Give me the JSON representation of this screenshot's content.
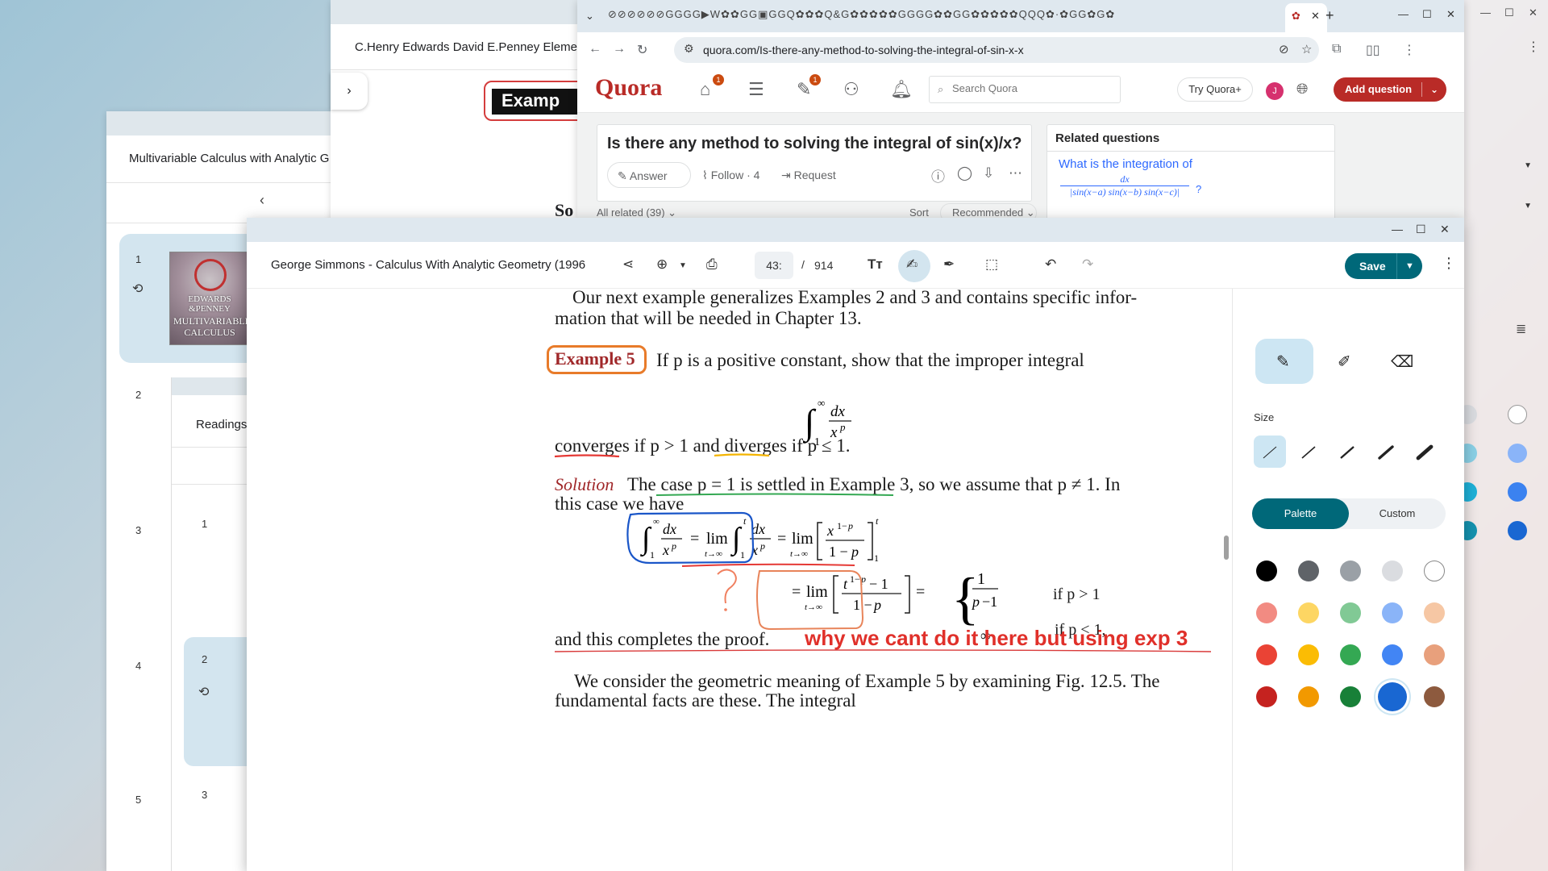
{
  "multi_window": {
    "title": "Multivariable Calculus with Analytic G",
    "thumb_pages": [
      "1",
      "2",
      "3",
      "4",
      "5"
    ],
    "cover_lines": [
      "EDWARDS",
      "&PENNEY",
      "MULTIVARIABLE",
      "CALCULUS"
    ],
    "sub_panel_label": "Readings",
    "sub_pages": [
      "1",
      "2",
      "3"
    ]
  },
  "edwards_window": {
    "title": "C.Henry Edwards David E.Penney Element",
    "heading_fragment": "Examp",
    "body_fragment": "So"
  },
  "chrome": {
    "tab_icons_text": "⊘⊘⊘⊘⊘⊘GGGG▶W✿✿GG▣GGQ✿✿✿Q&G✿✿✿✿✿GGGG✿✿GG✿✿✿✿✿QQQ✿·✿GG✿G✿",
    "url": "quora.com/Is-there-any-method-to-solving-the-integral-of-sin-x-x"
  },
  "quora": {
    "logo": "Quora",
    "home_badge": "1",
    "write_badge": "1",
    "search_placeholder": "Search Quora",
    "try_plus": "Try Quora+",
    "avatar_letter": "J",
    "add_question": "Add question",
    "question_title": "Is there any method to solving the integral of sin(x)/x?",
    "answer_label": "Answer",
    "follow_label": "Follow · 4",
    "request_label": "Request",
    "related_heading": "Related questions",
    "related_link": "What is the integration of",
    "related_frac_num": "dx",
    "related_frac_den": "|sin(x−a) sin(x−b) sin(x−c)|",
    "related_qmark": "?",
    "all_related": "All related (39)",
    "sort_label": "Sort",
    "sort_value": "Recommended"
  },
  "pdf": {
    "title": "George Simmons - Calculus With Analytic Geometry (1996",
    "page_current": "43:",
    "page_separator": "/",
    "page_total": "914",
    "save_label": "Save",
    "content": {
      "line1": "Our next example generalizes Examples 2 and 3 and contains specific infor-",
      "line2": "mation that will be needed in Chapter 13.",
      "example_label": "Example 5",
      "example_text": "If p is a positive constant, show that the improper integral",
      "converges_line": "converges if p > 1 and diverges if p ≤ 1.",
      "solution_label": "Solution",
      "solution_text": "The case p = 1 is settled in Example 3, so we assume that p ≠ 1. In",
      "solution_text2": "this case we have",
      "case1_cond": "if p > 1",
      "case2_cond": "if p < 1,",
      "proof_line": "and this completes the proof.",
      "handwritten_note": "why we cant do it here but using exp 3",
      "para1": "We consider the geometric meaning of Example 5 by examining Fig. 12.5. The",
      "para2": "fundamental facts are these. The integral"
    }
  },
  "ink_panel": {
    "size_label": "Size",
    "palette_label": "Palette",
    "custom_label": "Custom",
    "colors": [
      [
        "#000000",
        "#5f6368",
        "#9aa0a6",
        "#dadce0",
        "#ffffff"
      ],
      [
        "#f28b82",
        "#fdd663",
        "#81c995",
        "#8ab4f8",
        "#f6c7a4"
      ],
      [
        "#ea4335",
        "#fbbc04",
        "#34a853",
        "#4285f4",
        "#e8a07c"
      ],
      [
        "#c5221f",
        "#f29900",
        "#188038",
        "#1967d2",
        "#8d5a3e"
      ]
    ],
    "selected_color": "#1967d2"
  }
}
